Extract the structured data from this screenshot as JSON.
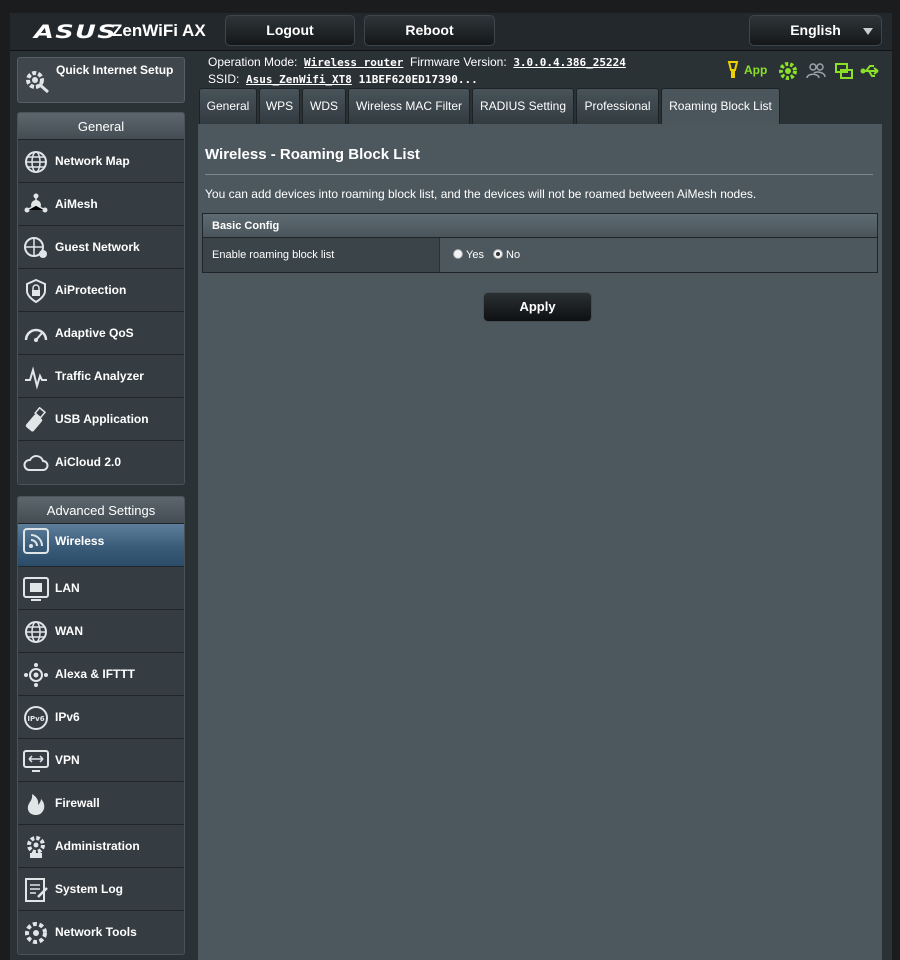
{
  "header": {
    "logo": "ASUS",
    "model": "ZenWiFi AX",
    "logout_label": "Logout",
    "reboot_label": "Reboot",
    "language": "English"
  },
  "status": {
    "op_mode_label": "Operation Mode:",
    "op_mode_value": "Wireless router",
    "fw_label": "Firmware Version:",
    "fw_value": "3.0.0.4.386_25224",
    "ssid_label": "SSID:",
    "ssid_value": "Asus_ZenWifi_XT8",
    "ssid_extra": "11BEF620ED17390...",
    "app_label": "App"
  },
  "sidebar": {
    "quick_setup": "Quick Internet Setup",
    "general_header": "General",
    "general_items": [
      {
        "label": "Network Map",
        "icon": "network-map-icon"
      },
      {
        "label": "AiMesh",
        "icon": "aimesh-icon"
      },
      {
        "label": "Guest Network",
        "icon": "guest-network-icon"
      },
      {
        "label": "AiProtection",
        "icon": "aiprotection-icon"
      },
      {
        "label": "Adaptive QoS",
        "icon": "qos-icon"
      },
      {
        "label": "Traffic Analyzer",
        "icon": "traffic-analyzer-icon"
      },
      {
        "label": "USB Application",
        "icon": "usb-icon"
      },
      {
        "label": "AiCloud 2.0",
        "icon": "aicloud-icon"
      }
    ],
    "advanced_header": "Advanced Settings",
    "advanced_items": [
      {
        "label": "Wireless",
        "icon": "wireless-icon",
        "active": true
      },
      {
        "label": "LAN",
        "icon": "lan-icon"
      },
      {
        "label": "WAN",
        "icon": "wan-icon"
      },
      {
        "label": "Alexa & IFTTT",
        "icon": "alexa-icon"
      },
      {
        "label": "IPv6",
        "icon": "ipv6-icon"
      },
      {
        "label": "VPN",
        "icon": "vpn-icon"
      },
      {
        "label": "Firewall",
        "icon": "firewall-icon"
      },
      {
        "label": "Administration",
        "icon": "administration-icon"
      },
      {
        "label": "System Log",
        "icon": "system-log-icon"
      },
      {
        "label": "Network Tools",
        "icon": "network-tools-icon"
      }
    ]
  },
  "tabs": [
    {
      "label": "General"
    },
    {
      "label": "WPS"
    },
    {
      "label": "WDS"
    },
    {
      "label": "Wireless MAC Filter"
    },
    {
      "label": "RADIUS Setting"
    },
    {
      "label": "Professional"
    },
    {
      "label": "Roaming Block List",
      "active": true
    }
  ],
  "content": {
    "title": "Wireless - Roaming Block List",
    "description": "You can add devices into roaming block list, and the devices will not be roamed between AiMesh nodes.",
    "section_header": "Basic Config",
    "enable_label": "Enable roaming block list",
    "yes_label": "Yes",
    "no_label": "No",
    "selected": "No",
    "apply_label": "Apply"
  },
  "colors": {
    "accent_green": "#8be028",
    "app_yellow": "#f0d000",
    "active_item": "#3b5c78"
  }
}
